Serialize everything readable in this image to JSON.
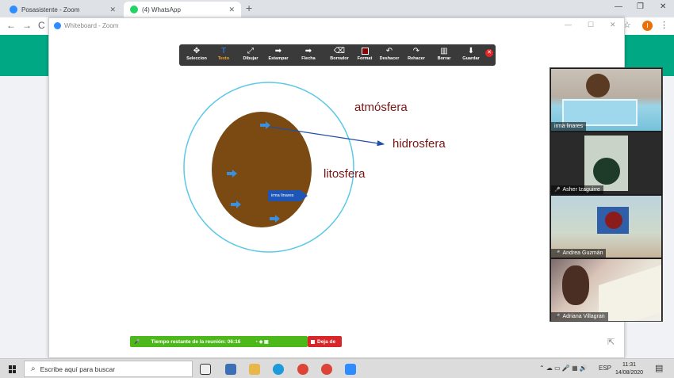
{
  "browser": {
    "tabs": [
      {
        "title": "Posasistente - Zoom",
        "icon": "zoom-icon",
        "color": "#2d8cff"
      },
      {
        "title": "(4) WhatsApp",
        "icon": "whatsapp-icon",
        "color": "#25d366"
      }
    ],
    "new_tab": "+",
    "profile_initial": "I"
  },
  "whiteboard": {
    "window_title": "Whiteboard - Zoom",
    "tools": [
      {
        "label": "Seleccion",
        "icon": "move-icon",
        "glyph": "✥"
      },
      {
        "label": "Texto",
        "icon": "text-icon",
        "glyph": "T",
        "active": true
      },
      {
        "label": "Dibujar",
        "icon": "draw-icon",
        "glyph": "⤢"
      },
      {
        "label": "Estampar",
        "icon": "stamp-icon",
        "glyph": "➡"
      },
      {
        "label": "Flecha",
        "icon": "arrow-icon",
        "glyph": "➡"
      },
      {
        "label": "Borrador",
        "icon": "eraser-icon",
        "glyph": "⌫"
      },
      {
        "label": "Format",
        "icon": "format-color-icon",
        "glyph": "■"
      },
      {
        "label": "Deshacer",
        "icon": "undo-icon",
        "glyph": "↶"
      },
      {
        "label": "Rehacer",
        "icon": "redo-icon",
        "glyph": "↷"
      },
      {
        "label": "Borrar",
        "icon": "trash-icon",
        "glyph": "🗑"
      },
      {
        "label": "Guardar",
        "icon": "save-icon",
        "glyph": "⬇"
      }
    ],
    "labels": {
      "atmosfera": "atmósfera",
      "hidrosfera": "hidrosfera",
      "litosfera": "litosfera"
    },
    "annotator_name": "irma linares",
    "colors": {
      "atmosphere": "#5bc8e8",
      "lithosphere": "#7a4a12",
      "stamp_arrow": "#3b8fe0",
      "label_text": "#7a1616",
      "arrow_line": "#1f4fa8"
    }
  },
  "meeting": {
    "remaining_label": "Tiempo restante de la reunión: 06:16",
    "leave_label": "Deja de"
  },
  "participants": [
    {
      "name": "irma linares",
      "muted": false
    },
    {
      "name": "Asher Izaguirre",
      "muted": true
    },
    {
      "name": "Andrea Guzmán",
      "muted": true
    },
    {
      "name": "Adriana Villagran",
      "muted": true
    }
  ],
  "taskbar": {
    "search_placeholder": "Escribe aquí para buscar",
    "language": "ESP",
    "time": "11:31",
    "date": "14/08/2020"
  }
}
